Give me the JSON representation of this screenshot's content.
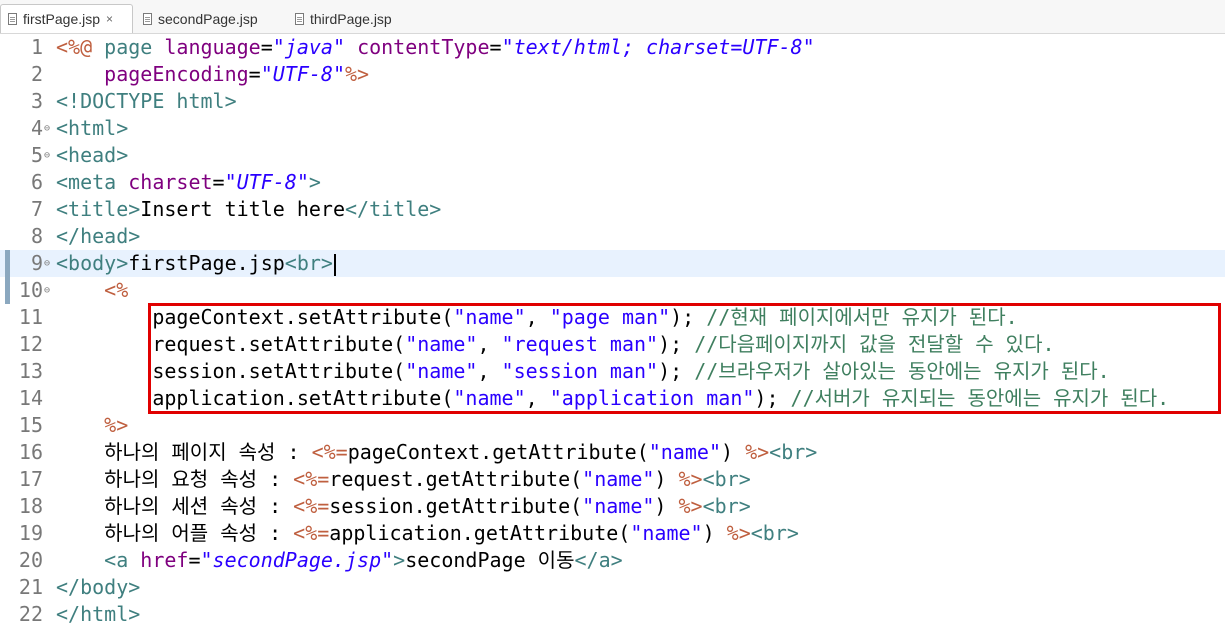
{
  "tabs": [
    {
      "label": "firstPage.jsp",
      "active": true
    },
    {
      "label": "secondPage.jsp",
      "active": false
    },
    {
      "label": "thirdPage.jsp",
      "active": false
    }
  ],
  "close_glyph": "×",
  "current_line": 9,
  "highlight_box_lines": [
    11,
    14
  ],
  "colors": {
    "tag": "#3f7f7f",
    "attr": "#7f007f",
    "value": "#2a00ff",
    "jsp_delim": "#bf5f3f",
    "comment": "#3f7f5f",
    "plain": "#000000",
    "highlight_box": "#e00000",
    "current_line_bg": "#e8f2fe"
  },
  "lines": [
    {
      "n": 1,
      "segs": [
        [
          "<%@ ",
          "jsp"
        ],
        [
          "page ",
          "tag"
        ],
        [
          "language",
          "attr"
        ],
        [
          "=",
          "plain"
        ],
        [
          "\"java\"",
          "value"
        ],
        [
          " ",
          "plain"
        ],
        [
          "contentType",
          "attr"
        ],
        [
          "=",
          "plain"
        ],
        [
          "\"text/html; charset=UTF-8\"",
          "value"
        ]
      ]
    },
    {
      "n": 2,
      "segs": [
        [
          "    ",
          "plain"
        ],
        [
          "pageEncoding",
          "attr"
        ],
        [
          "=",
          "plain"
        ],
        [
          "\"UTF-8\"",
          "value"
        ],
        [
          "%>",
          "jsp"
        ]
      ]
    },
    {
      "n": 3,
      "segs": [
        [
          "<!DOCTYPE html>",
          "tag"
        ]
      ]
    },
    {
      "n": 4,
      "fold": true,
      "segs": [
        [
          "<html>",
          "tag"
        ]
      ]
    },
    {
      "n": 5,
      "fold": true,
      "segs": [
        [
          "<head>",
          "tag"
        ]
      ]
    },
    {
      "n": 6,
      "segs": [
        [
          "<meta ",
          "tag"
        ],
        [
          "charset",
          "attr"
        ],
        [
          "=",
          "plain"
        ],
        [
          "\"UTF-8\"",
          "value"
        ],
        [
          ">",
          "tag"
        ]
      ]
    },
    {
      "n": 7,
      "segs": [
        [
          "<title>",
          "tag"
        ],
        [
          "Insert title here",
          "plain"
        ],
        [
          "</title>",
          "tag"
        ]
      ]
    },
    {
      "n": 8,
      "segs": [
        [
          "</head>",
          "tag"
        ]
      ]
    },
    {
      "n": 9,
      "fold": true,
      "segs": [
        [
          "<body>",
          "tag"
        ],
        [
          "firstPage.jsp",
          "plain"
        ],
        [
          "<br>",
          "tag"
        ]
      ]
    },
    {
      "n": 10,
      "fold": true,
      "segs": [
        [
          "    ",
          "plain"
        ],
        [
          "<%",
          "jsp"
        ]
      ]
    },
    {
      "n": 11,
      "segs": [
        [
          "        pageContext.setAttribute(",
          "plain"
        ],
        [
          "\"name\"",
          "value"
        ],
        [
          ", ",
          "plain"
        ],
        [
          "\"page man\"",
          "value"
        ],
        [
          "); ",
          "plain"
        ],
        [
          "//현재 페이지에서만 유지가 된다.",
          "comment"
        ]
      ]
    },
    {
      "n": 12,
      "segs": [
        [
          "        request.setAttribute(",
          "plain"
        ],
        [
          "\"name\"",
          "value"
        ],
        [
          ", ",
          "plain"
        ],
        [
          "\"request man\"",
          "value"
        ],
        [
          "); ",
          "plain"
        ],
        [
          "//다음페이지까지 값을 전달할 수 있다.",
          "comment"
        ]
      ]
    },
    {
      "n": 13,
      "segs": [
        [
          "        session.setAttribute(",
          "plain"
        ],
        [
          "\"name\"",
          "value"
        ],
        [
          ", ",
          "plain"
        ],
        [
          "\"session man\"",
          "value"
        ],
        [
          "); ",
          "plain"
        ],
        [
          "//브라우저가 살아있는 동안에는 유지가 된다.",
          "comment"
        ]
      ]
    },
    {
      "n": 14,
      "segs": [
        [
          "        application.setAttribute(",
          "plain"
        ],
        [
          "\"name\"",
          "value"
        ],
        [
          ", ",
          "plain"
        ],
        [
          "\"application man\"",
          "value"
        ],
        [
          "); ",
          "plain"
        ],
        [
          "//서버가 유지되는 동안에는 유지가 된다.",
          "comment"
        ]
      ]
    },
    {
      "n": 15,
      "segs": [
        [
          "    ",
          "plain"
        ],
        [
          "%>",
          "jsp"
        ]
      ]
    },
    {
      "n": 16,
      "segs": [
        [
          "    하나의 페이지 속성 : ",
          "plain"
        ],
        [
          "<%=",
          "jsp"
        ],
        [
          "pageContext.getAttribute(",
          "plain"
        ],
        [
          "\"name\"",
          "value"
        ],
        [
          ") ",
          "plain"
        ],
        [
          "%>",
          "jsp"
        ],
        [
          "<br>",
          "tag"
        ]
      ]
    },
    {
      "n": 17,
      "segs": [
        [
          "    하나의 요청 속성 : ",
          "plain"
        ],
        [
          "<%=",
          "jsp"
        ],
        [
          "request.getAttribute(",
          "plain"
        ],
        [
          "\"name\"",
          "value"
        ],
        [
          ") ",
          "plain"
        ],
        [
          "%>",
          "jsp"
        ],
        [
          "<br>",
          "tag"
        ]
      ]
    },
    {
      "n": 18,
      "segs": [
        [
          "    하나의 세션 속성 : ",
          "plain"
        ],
        [
          "<%=",
          "jsp"
        ],
        [
          "session.getAttribute(",
          "plain"
        ],
        [
          "\"name\"",
          "value"
        ],
        [
          ") ",
          "plain"
        ],
        [
          "%>",
          "jsp"
        ],
        [
          "<br>",
          "tag"
        ]
      ]
    },
    {
      "n": 19,
      "segs": [
        [
          "    하나의 어플 속성 : ",
          "plain"
        ],
        [
          "<%=",
          "jsp"
        ],
        [
          "application.getAttribute(",
          "plain"
        ],
        [
          "\"name\"",
          "value"
        ],
        [
          ") ",
          "plain"
        ],
        [
          "%>",
          "jsp"
        ],
        [
          "<br>",
          "tag"
        ]
      ]
    },
    {
      "n": 20,
      "segs": [
        [
          "    ",
          "plain"
        ],
        [
          "<a ",
          "tag"
        ],
        [
          "href",
          "attr"
        ],
        [
          "=",
          "plain"
        ],
        [
          "\"secondPage.jsp\"",
          "value"
        ],
        [
          ">",
          "tag"
        ],
        [
          "secondPage 이동",
          "plain"
        ],
        [
          "</a>",
          "tag"
        ]
      ]
    },
    {
      "n": 21,
      "segs": [
        [
          "</body>",
          "tag"
        ]
      ]
    },
    {
      "n": 22,
      "segs": [
        [
          "</html>",
          "tag"
        ]
      ]
    }
  ]
}
